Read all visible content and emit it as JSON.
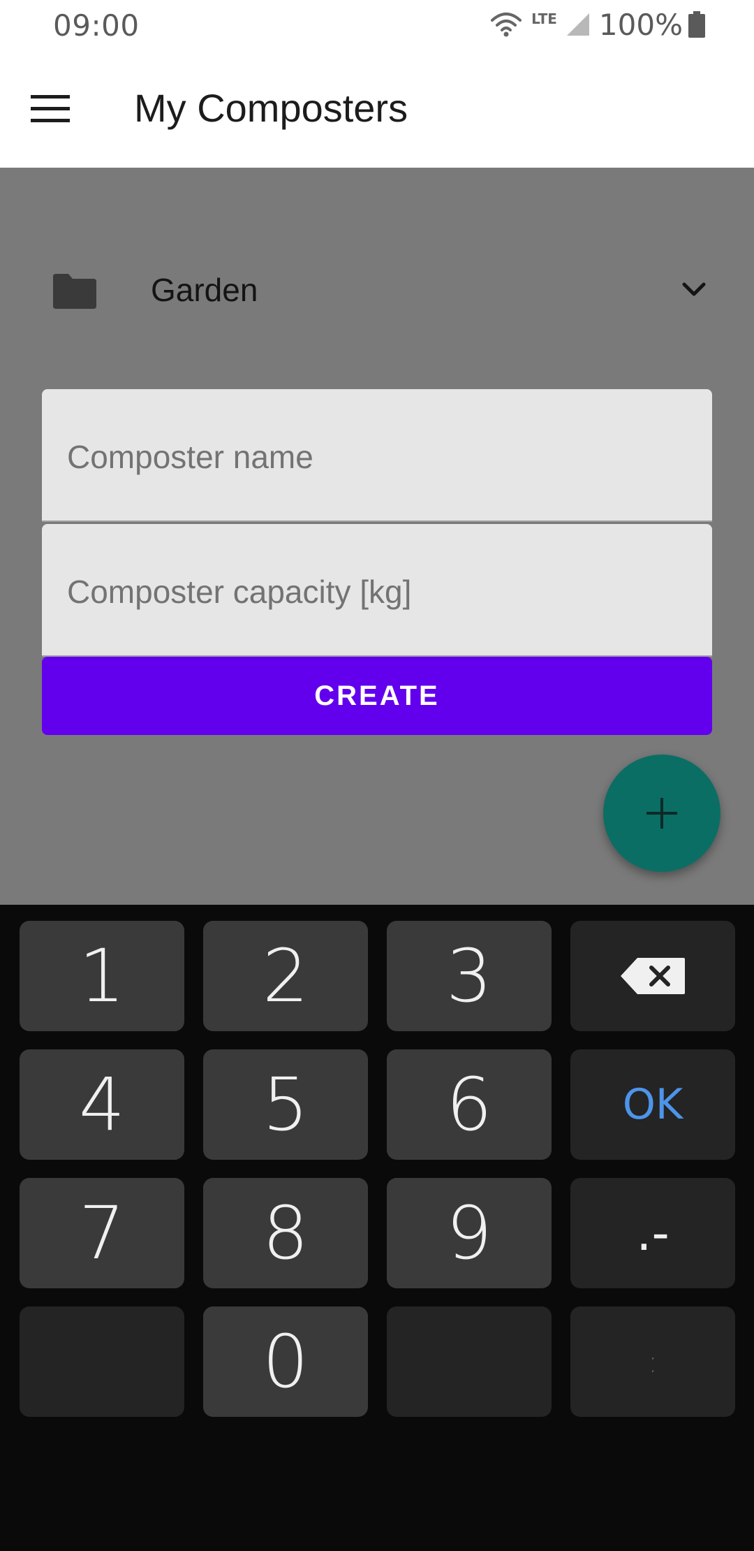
{
  "status_bar": {
    "time": "09:00",
    "network": "LTE",
    "battery": "100%",
    "icons": [
      "wifi-icon",
      "signal-icon",
      "battery-icon"
    ]
  },
  "app_bar": {
    "title": "My Composters",
    "menu_icon": "menu-icon"
  },
  "folder_selector": {
    "label": "Garden",
    "icon": "folder-icon",
    "dropdown_icon": "chevron-down-icon"
  },
  "form": {
    "name_placeholder": "Composter name",
    "capacity_placeholder": "Composter capacity [kg]",
    "create_label": "CREATE"
  },
  "fab": {
    "icon": "plus-icon"
  },
  "keyboard": {
    "rows": [
      [
        "1",
        "2",
        "3",
        "⌫"
      ],
      [
        "4",
        "5",
        "6",
        "OK"
      ],
      [
        "7",
        "8",
        "9",
        ".-"
      ],
      [
        "",
        "0",
        "",
        ":"
      ]
    ],
    "ok_color": "#4d94ea"
  },
  "colors": {
    "accent": "#6200ee",
    "fab": "#0b6e65",
    "scrim": "#7a7a7a"
  }
}
